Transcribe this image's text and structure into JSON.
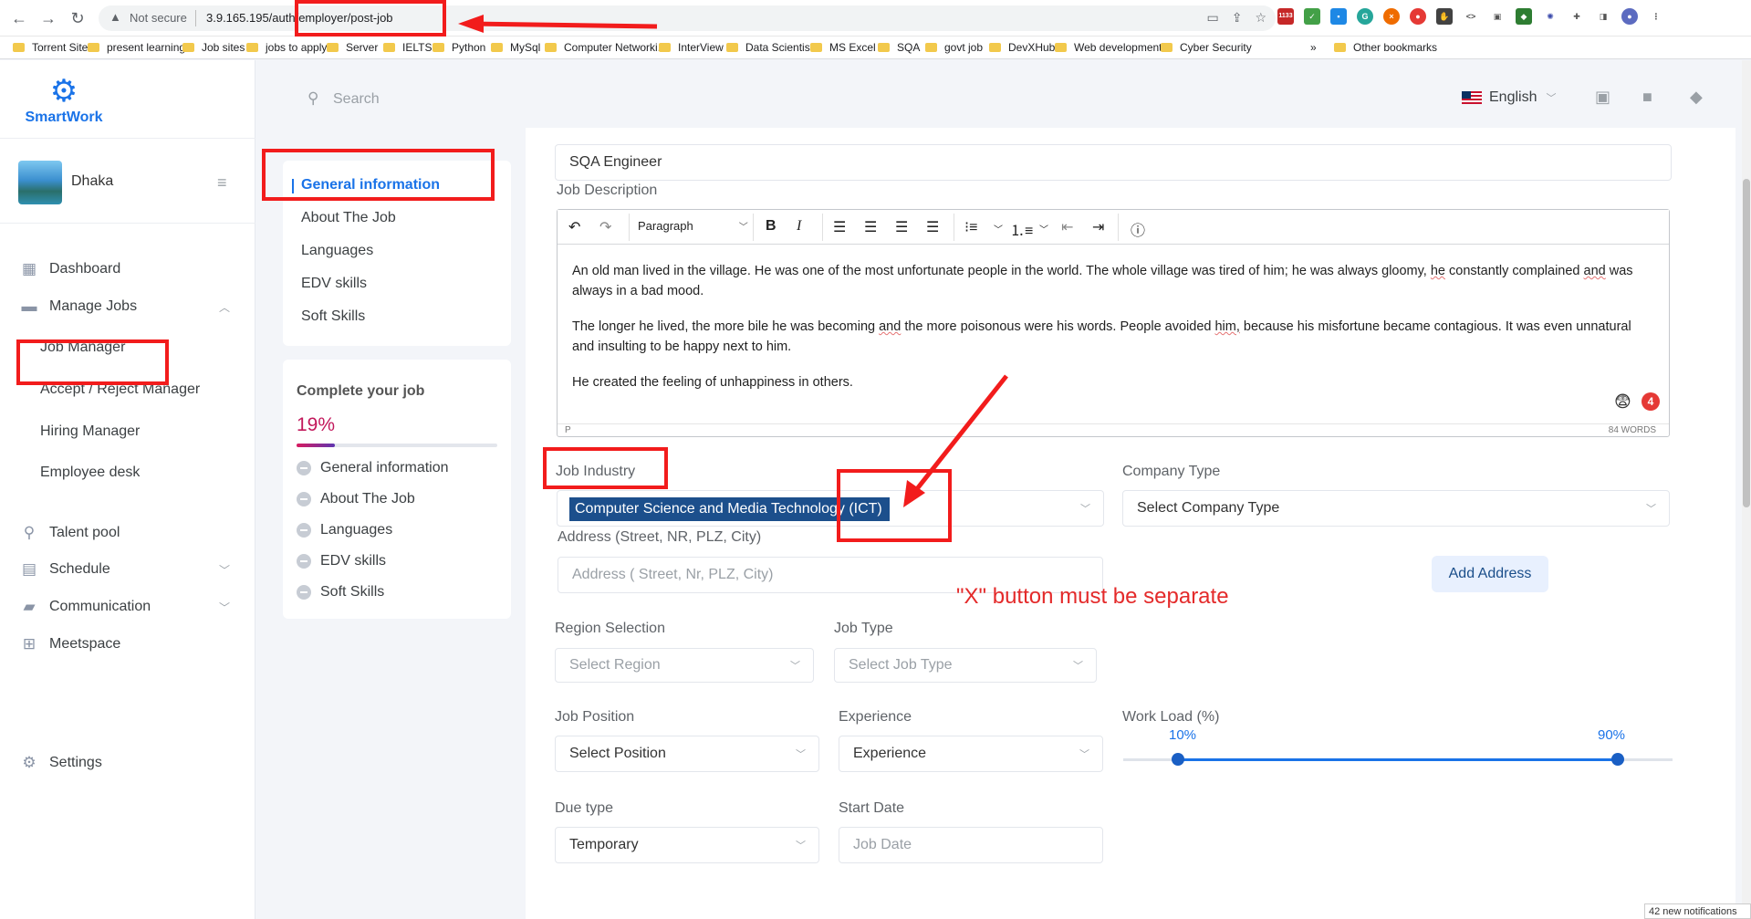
{
  "browser": {
    "security": "Not secure",
    "url": "3.9.165.195/auth/employer/post-job",
    "badge_count": "1133",
    "bookmarks": [
      "Torrent Site",
      "present learning",
      "Job sites",
      "jobs to apply",
      "Server",
      "IELTS",
      "Python",
      "MySql",
      "Computer Networki...",
      "InterView",
      "Data Scientist",
      "MS Excel",
      "SQA",
      "govt job",
      "DevXHub",
      "Web development",
      "Cyber Security"
    ],
    "bookmarks_more": "»",
    "other_bookmarks": "Other bookmarks"
  },
  "sidebar": {
    "brand": "SmartWork",
    "profile_name": "Dhaka",
    "nav": {
      "dashboard": "Dashboard",
      "manage_jobs": "Manage Jobs",
      "talent_pool": "Talent pool",
      "schedule": "Schedule",
      "communication": "Communication",
      "meetspace": "Meetspace",
      "settings": "Settings"
    },
    "manage_jobs_sub": {
      "job_manager": "Job Manager",
      "accept_reject": "Accept / Reject Manager",
      "hiring": "Hiring Manager",
      "employee_desk": "Employee desk"
    }
  },
  "topbar": {
    "search_placeholder": "Search",
    "language": "English"
  },
  "sections": {
    "general": "General information",
    "about": "About The Job",
    "languages": "Languages",
    "edv": "EDV skills",
    "soft": "Soft Skills"
  },
  "completion": {
    "title": "Complete your job",
    "percent_label": "19%",
    "percent_value": 19,
    "items": [
      "General information",
      "About The Job",
      "Languages",
      "EDV skills",
      "Soft Skills"
    ]
  },
  "form": {
    "job_title_value": "SQA Engineer",
    "job_description_label": "Job Description",
    "editor": {
      "paragraph_format": "Paragraph",
      "p1a": "An old man lived in the village. He was one of the most unfortunate people in the world. The whole village was tired of him; he was always gloomy, ",
      "p1b": "he",
      "p1c": " constantly complained ",
      "p1d": "and",
      "p1e": " was always in a bad mood.",
      "p2a": "The longer he lived, the more bile he was becoming ",
      "p2b": "and",
      "p2c": " the more poisonous were his words. People avoided ",
      "p2d": "him,",
      "p2e": " because his misfortune became contagious. It was even unnatural and insulting to be happy next to him.",
      "p3": "He created the feeling of unhappiness in others.",
      "status_tag": "P",
      "word_count": "84 WORDS",
      "emoji_badge": "4"
    },
    "job_industry_label": "Job Industry",
    "job_industry_value": "Computer Science and Media Technology (ICT)",
    "company_type_label": "Company Type",
    "company_type_placeholder": "Select Company Type",
    "address_label": "Address (Street, NR, PLZ, City)",
    "address_placeholder": "Address ( Street, Nr, PLZ, City)",
    "add_address_button": "Add Address",
    "region_label": "Region Selection",
    "region_placeholder": "Select Region",
    "job_type_label": "Job Type",
    "job_type_placeholder": "Select Job Type",
    "position_label": "Job Position",
    "position_value": "Select Position",
    "experience_label": "Experience",
    "experience_value": "Experience",
    "workload_label": "Work Load (%)",
    "workload_min_label": "10%",
    "workload_max_label": "90%",
    "workload_min": 10,
    "workload_max": 90,
    "due_type_label": "Due type",
    "due_type_value": "Temporary",
    "start_date_label": "Start Date",
    "start_date_placeholder": "Job Date"
  },
  "annotation": {
    "note": "\"X\" button must be separate",
    "color": "#f21c1c"
  },
  "status": {
    "notifications": "42 new notifications"
  }
}
